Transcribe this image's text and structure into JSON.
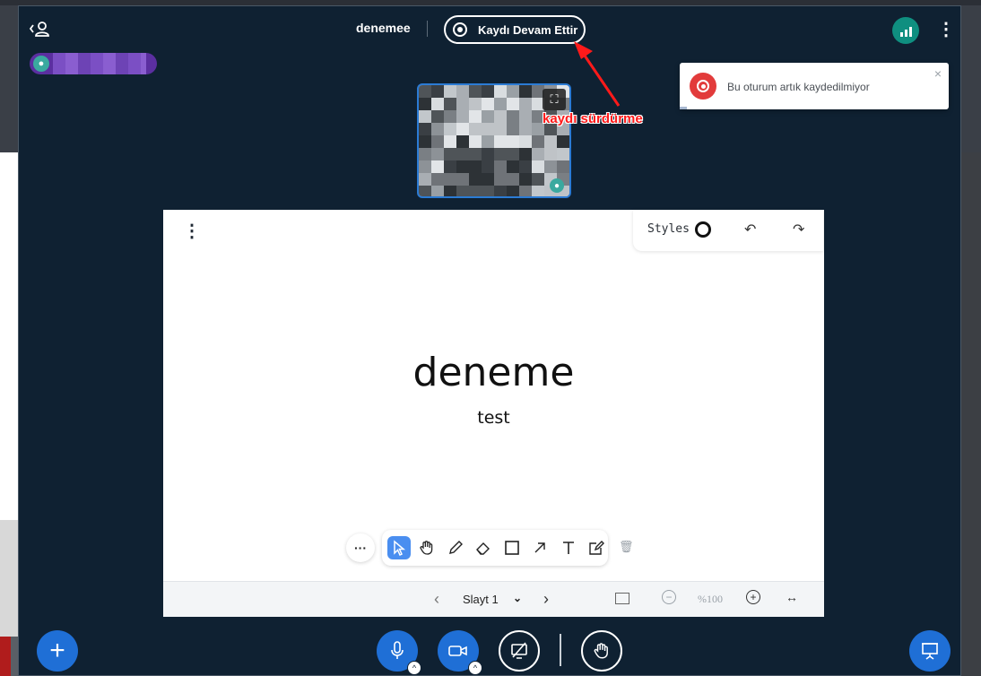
{
  "header": {
    "meeting_title": "denemee",
    "record_button_label": "Kaydı Devam Ettir"
  },
  "toast": {
    "message": "Bu oturum artık kaydedilmiyor",
    "close_icon": "×"
  },
  "annotation": {
    "label": "kaydı sürdürme",
    "color": "#ff1a1a"
  },
  "whiteboard": {
    "styles_label": "Styles",
    "slide_title": "deneme",
    "slide_subtitle": "test",
    "tools": [
      "select-icon",
      "pan-icon",
      "pencil-icon",
      "eraser-icon",
      "rectangle-icon",
      "arrow-icon",
      "text-icon",
      "note-icon"
    ],
    "active_tool": "select-icon",
    "more_label": "···"
  },
  "slide_nav": {
    "slide_label": "Slayt 1",
    "zoom_label": "%100"
  },
  "colors": {
    "app_background": "#0f2132",
    "accent_blue": "#1f6fd6",
    "connection_green": "#0f8f80",
    "toast_red": "#e23b3b",
    "talker_purple": "#5b2fa0"
  }
}
